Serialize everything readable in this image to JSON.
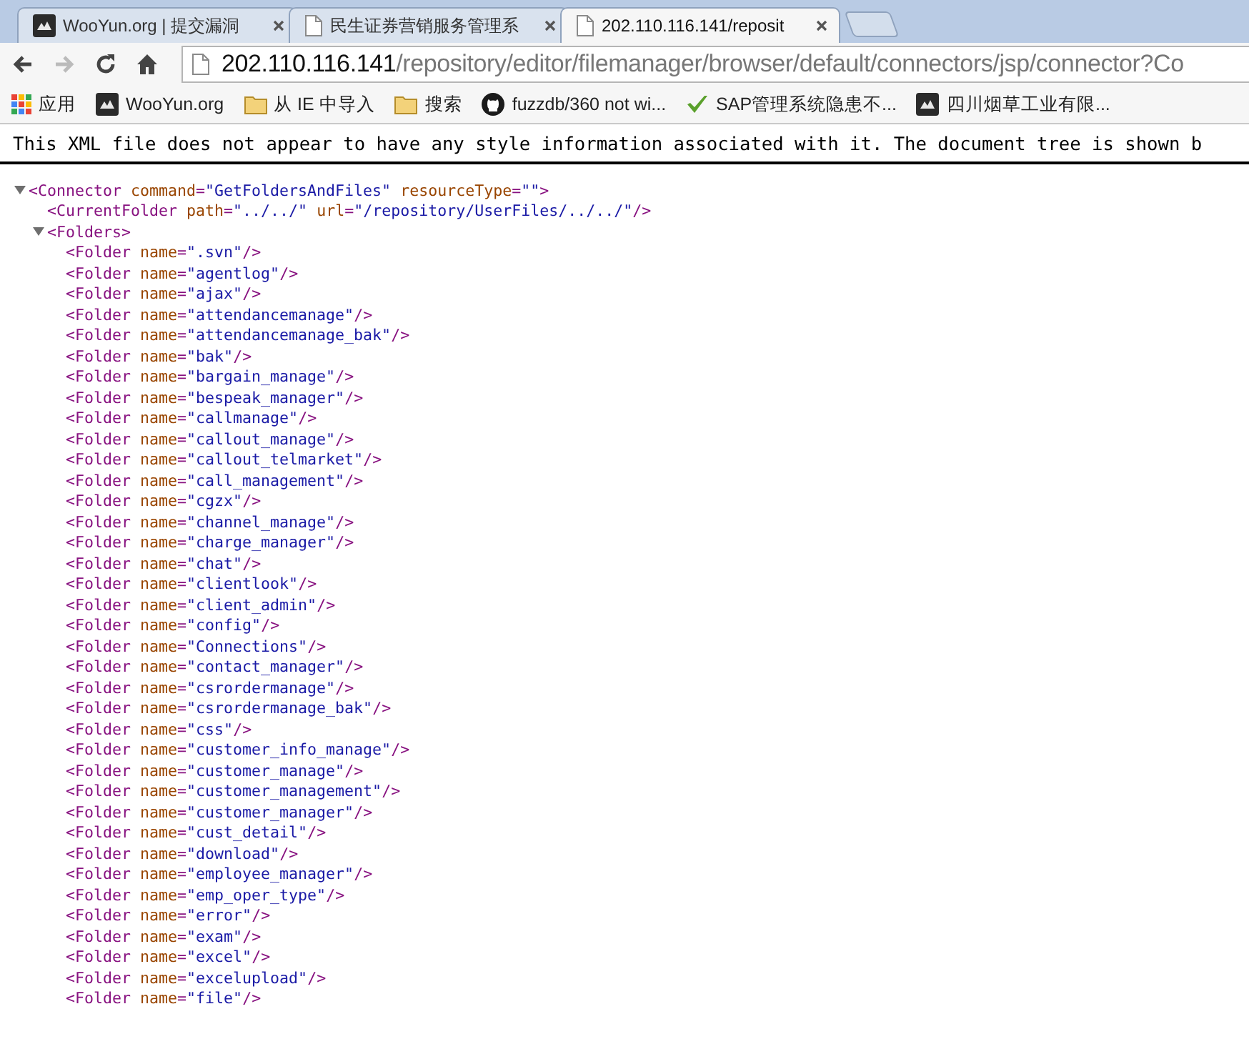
{
  "tabs": [
    {
      "title": "WooYun.org | 提交漏洞",
      "kind": "logo",
      "selected": false
    },
    {
      "title": "民生证券营销服务管理系",
      "kind": "page",
      "selected": false
    },
    {
      "title": "202.110.116.141/reposit",
      "kind": "page",
      "selected": true
    }
  ],
  "toolbar": {
    "back_disabled": false,
    "forward_disabled": true
  },
  "address_bar": {
    "host": "202.110.116.141",
    "path": "/repository/editor/filemanager/browser/default/connectors/jsp/connector?Co"
  },
  "bookmarks": [
    {
      "label": "应用",
      "kind": "apps"
    },
    {
      "label": "WooYun.org",
      "kind": "logo"
    },
    {
      "label": "从 IE 中导入",
      "kind": "folder"
    },
    {
      "label": "搜索",
      "kind": "folder"
    },
    {
      "label": "fuzzdb/360 not wi...",
      "kind": "github"
    },
    {
      "label": "SAP管理系统隐患不...",
      "kind": "check"
    },
    {
      "label": "四川烟草工业有限...",
      "kind": "logo"
    }
  ],
  "xml_notice": "This XML file does not appear to have any style information associated with it. The document tree is shown b",
  "xml_tree": {
    "text": "<Connector command=\"GetFoldersAndFiles\" resourceType=\"\">",
    "expanded": true,
    "children": [
      {
        "text": "<CurrentFolder path=\"../../\" url=\"/repository/UserFiles/../../\"/>"
      },
      {
        "text": "<Folders>",
        "expanded": true,
        "children": [
          {
            "text": "<Folder name=\".svn\"/>"
          },
          {
            "text": "<Folder name=\"agentlog\"/>"
          },
          {
            "text": "<Folder name=\"ajax\"/>"
          },
          {
            "text": "<Folder name=\"attendancemanage\"/>"
          },
          {
            "text": "<Folder name=\"attendancemanage_bak\"/>"
          },
          {
            "text": "<Folder name=\"bak\"/>"
          },
          {
            "text": "<Folder name=\"bargain_manage\"/>"
          },
          {
            "text": "<Folder name=\"bespeak_manager\"/>"
          },
          {
            "text": "<Folder name=\"callmanage\"/>"
          },
          {
            "text": "<Folder name=\"callout_manage\"/>"
          },
          {
            "text": "<Folder name=\"callout_telmarket\"/>"
          },
          {
            "text": "<Folder name=\"call_management\"/>"
          },
          {
            "text": "<Folder name=\"cgzx\"/>"
          },
          {
            "text": "<Folder name=\"channel_manage\"/>"
          },
          {
            "text": "<Folder name=\"charge_manager\"/>"
          },
          {
            "text": "<Folder name=\"chat\"/>"
          },
          {
            "text": "<Folder name=\"clientlook\"/>"
          },
          {
            "text": "<Folder name=\"client_admin\"/>"
          },
          {
            "text": "<Folder name=\"config\"/>"
          },
          {
            "text": "<Folder name=\"Connections\"/>"
          },
          {
            "text": "<Folder name=\"contact_manager\"/>"
          },
          {
            "text": "<Folder name=\"csrordermanage\"/>"
          },
          {
            "text": "<Folder name=\"csrordermanage_bak\"/>"
          },
          {
            "text": "<Folder name=\"css\"/>"
          },
          {
            "text": "<Folder name=\"customer_info_manage\"/>"
          },
          {
            "text": "<Folder name=\"customer_manage\"/>"
          },
          {
            "text": "<Folder name=\"customer_management\"/>"
          },
          {
            "text": "<Folder name=\"customer_manager\"/>"
          },
          {
            "text": "<Folder name=\"cust_detail\"/>"
          },
          {
            "text": "<Folder name=\"download\"/>"
          },
          {
            "text": "<Folder name=\"employee_manager\"/>"
          },
          {
            "text": "<Folder name=\"emp_oper_type\"/>"
          },
          {
            "text": "<Folder name=\"error\"/>"
          },
          {
            "text": "<Folder name=\"exam\"/>"
          },
          {
            "text": "<Folder name=\"excel\"/>"
          },
          {
            "text": "<Folder name=\"excelupload\"/>"
          },
          {
            "text": "<Folder name=\"file\"/>"
          }
        ]
      }
    ]
  }
}
